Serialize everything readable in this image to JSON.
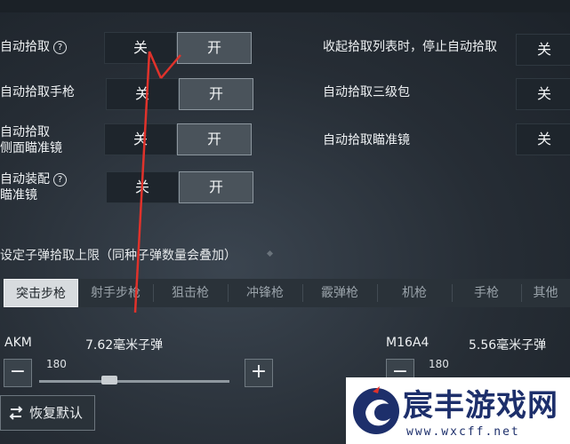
{
  "settings": {
    "auto_pickup": {
      "label": "自动拾取",
      "help": "?",
      "off": "关",
      "on": "开"
    },
    "auto_pickup_pistol": {
      "label": "自动拾取手枪",
      "off": "关",
      "on": "开"
    },
    "auto_pickup_side_scope": {
      "label_line1": "自动拾取",
      "label_line2": "侧面瞄准镜",
      "off": "关",
      "on": "开"
    },
    "auto_equip_scope": {
      "label_line1": "自动装配",
      "label_line2": "瞄准镜",
      "help": "?",
      "off": "关",
      "on": "开"
    },
    "stop_on_collapse": {
      "label": "收起拾取列表时，停止自动拾取",
      "off": "关"
    },
    "auto_pickup_lv3_bag": {
      "label": "自动拾取三级包",
      "off": "关"
    },
    "auto_pickup_scope": {
      "label": "自动拾取瞄准镜",
      "off": "关"
    }
  },
  "ammo_section": {
    "title": "设定子弹拾取上限（同种子弹数量会叠加）"
  },
  "tabs": [
    "突击步枪",
    "射手步枪",
    "狙击枪",
    "冲锋枪",
    "霰弹枪",
    "机枪",
    "手枪",
    "其他"
  ],
  "selected_tab": "突击步枪",
  "weapons": [
    {
      "name": "AKM",
      "ammo": "7.62毫米子弹",
      "limit": "180"
    },
    {
      "name": "M16A4",
      "ammo": "5.56毫米子弹",
      "limit": "180"
    }
  ],
  "stepper": {
    "minus": "−",
    "plus": "+"
  },
  "reset_label": "恢复默认",
  "watermark": {
    "title": "宸丰游戏网",
    "url": "www.wxcff.net"
  },
  "colors": {
    "accent_red": "#e0322b",
    "panel_dark": "#1e252c",
    "toggle_on": "#4a535b"
  }
}
